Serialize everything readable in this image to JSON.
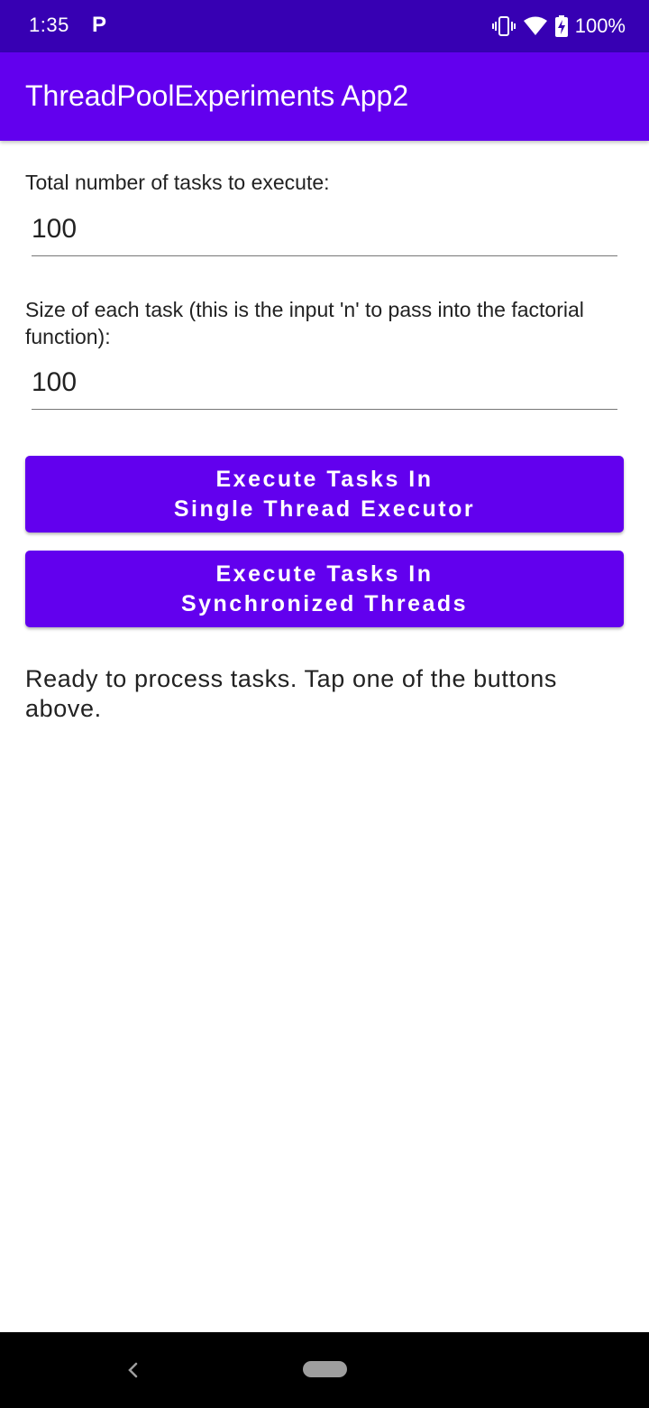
{
  "status_bar": {
    "time": "1:35",
    "notification_icon": "parking-p-icon",
    "battery_percent": "100%",
    "icons": [
      "vibrate-icon",
      "wifi-icon",
      "battery-charging-icon"
    ]
  },
  "app_bar": {
    "title": "ThreadPoolExperiments App2"
  },
  "form": {
    "tasks_label": "Total number of tasks to execute:",
    "tasks_value": "100",
    "size_label": "Size of each task (this is the input 'n' to pass into the factorial function):",
    "size_value": "100"
  },
  "buttons": {
    "single_thread": {
      "line1": "Execute Tasks In",
      "line2": "Single Thread Executor"
    },
    "synchronized": {
      "line1": "Execute Tasks In",
      "line2": "Synchronized Threads"
    }
  },
  "status_message": "Ready to process tasks. Tap one of the buttons above.",
  "nav_bar": {
    "icons": [
      "back-icon",
      "home-pill-icon"
    ]
  },
  "colors": {
    "status_bar": "#3700b3",
    "primary": "#6200ee",
    "nav_bar": "#000000"
  }
}
